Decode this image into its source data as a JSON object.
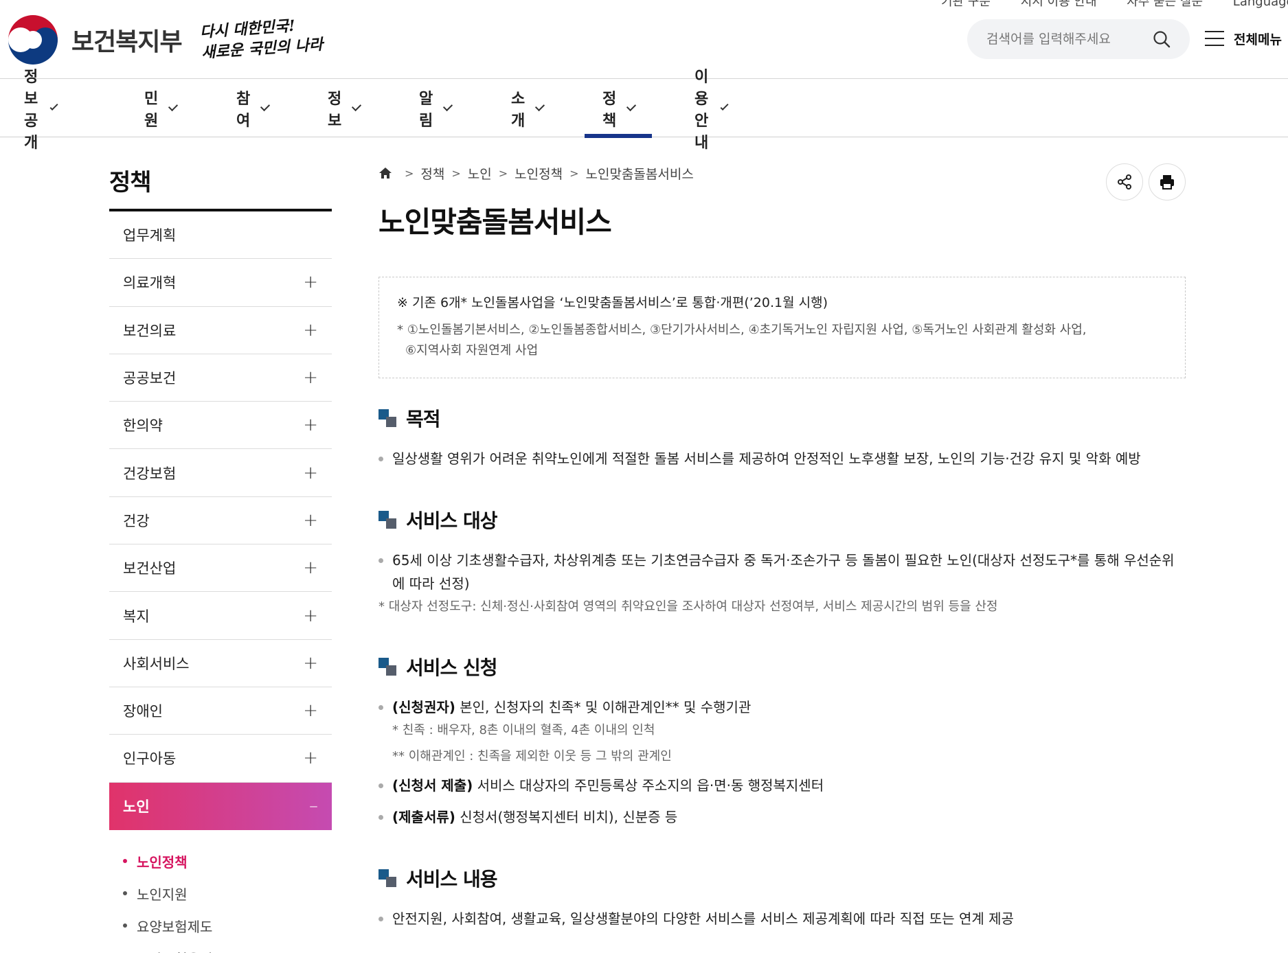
{
  "util": [
    "기관 구분",
    "지시 이용 안내",
    "자주 묻는 질문",
    "Language"
  ],
  "header": {
    "brand": "보건복지부",
    "slogan_line1": "다시 대한민국!",
    "slogan_line2": "새로운 국민의 나라",
    "search_placeholder": "검색어를 입력해주세요",
    "all_menu": "전체메뉴"
  },
  "gnb": [
    {
      "label": "정보공개"
    },
    {
      "label": "민원"
    },
    {
      "label": "참여"
    },
    {
      "label": "정보"
    },
    {
      "label": "알림"
    },
    {
      "label": "소개"
    },
    {
      "label": "정책",
      "active": true
    },
    {
      "label": "이용안내"
    }
  ],
  "sidebar": {
    "title": "정책",
    "items": [
      "업무계획",
      "의료개혁",
      "보건의료",
      "공공보건",
      "한의약",
      "건강보험",
      "건강",
      "보건산업",
      "복지",
      "사회서비스",
      "장애인",
      "인구아동",
      "노인"
    ],
    "expand_symbol": "+",
    "collapse_symbol": "–",
    "active_item": "노인",
    "sub_items": [
      "노인정책",
      "노인지원",
      "요양보험제도",
      "요양보험운영"
    ],
    "active_sub": "노인정책"
  },
  "breadcrumb": [
    "정책",
    "노인",
    "노인정책",
    "노인맞춤돌봄서비스"
  ],
  "page_title": "노인맞춤돌봄서비스",
  "notice": {
    "main": "※ 기존 6개* 노인돌봄사업을 ‘노인맞춤돌봄서비스’로 통합·개편(’20.1월 시행)",
    "sub_line1": "* ①노인돌봄기본서비스, ②노인돌봄종합서비스, ③단기가사서비스, ④초기독거노인 자립지원 사업, ⑤독거노인 사회관계 활성화 사업,",
    "sub_line2": "⑥지역사회 자원연계 사업"
  },
  "sections": {
    "purpose": {
      "title": "목적",
      "text": "일상생활 영위가 어려운 취약노인에게 적절한 돌봄 서비스를 제공하여 안정적인 노후생활 보장, 노인의 기능·건강 유지 및 악화 예방"
    },
    "target": {
      "title": "서비스 대상",
      "text": "65세 이상 기초생활수급자, 차상위계층 또는 기초연금수급자 중 독거·조손가구 등 돌봄이 필요한 노인(대상자 선정도구*를 통해 우선순위에 따라 선정)",
      "note": "* 대상자 선정도구: 신체·정신·사회참여 영역의 취약요인을 조사하여 대상자 선정여부, 서비스 제공시간의 범위 등을 산정"
    },
    "apply": {
      "title": "서비스 신청",
      "b1_bold": "(신청권자)",
      "b1_text": " 본인, 신청자의 친족* 및 이해관계인** 및 수행기관",
      "n1": "* 친족 : 배우자, 8촌 이내의 혈족, 4촌 이내의 인척",
      "n2": "** 이해관계인 : 친족을 제외한 이웃 등 그 밖의 관계인",
      "b2_bold": "(신청서 제출)",
      "b2_text": " 서비스 대상자의 주민등록상 주소지의 읍·면·동 행정복지센터",
      "b3_bold": "(제출서류)",
      "b3_text": " 신청서(행정복지센터 비치), 신분증 등"
    },
    "content": {
      "title": "서비스 내용",
      "text": "안전지원, 사회참여, 생활교육, 일상생활분야의 다양한 서비스를 서비스 제공계획에 따라 직접 또는 연계 제공"
    }
  },
  "colors": {
    "gnb_active": "#17348a",
    "sidebar_active_start": "#e0336a",
    "sidebar_active_end": "#c54bb1",
    "sub_active": "#d6145f",
    "square_a": "#1a5a8a",
    "square_b": "#555d6b"
  },
  "icons": [
    "taegeuk-logo-icon",
    "search-icon",
    "hamburger-icon",
    "chevron-down-icon",
    "home-icon",
    "share-icon",
    "print-icon",
    "plus-icon",
    "minus-icon"
  ]
}
